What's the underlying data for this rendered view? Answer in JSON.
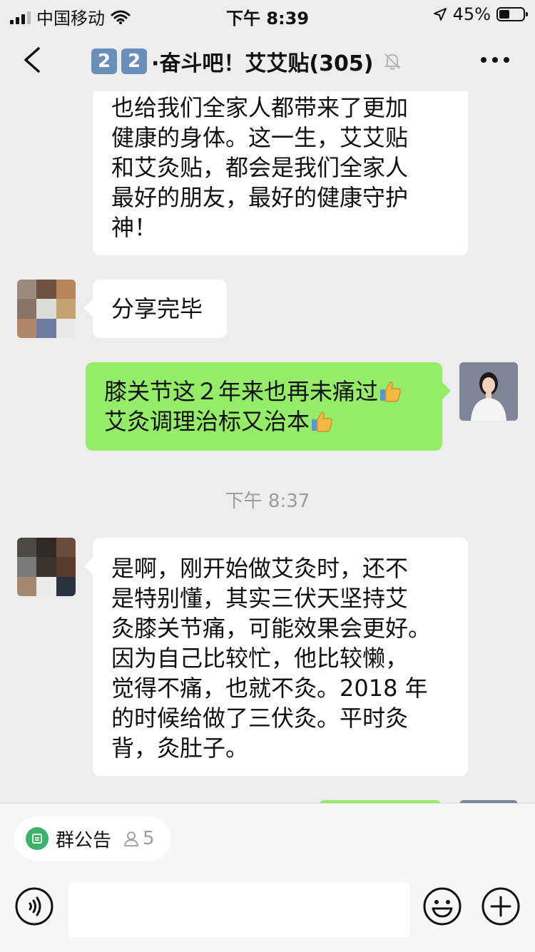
{
  "status_bar": {
    "carrier": "中国移动",
    "time": "下午 8:39",
    "battery": "45%",
    "battery_level": 0.45
  },
  "header": {
    "badge_1": "2",
    "badge_2": "2",
    "title": "·奋斗吧！艾艾贴(305)",
    "muted": true
  },
  "messages": {
    "m1_lines": [
      "也给我们全家人都带来了更加",
      "健康的身体。这一生，艾艾贴",
      "和艾灸贴，都会是我们全家人",
      "最好的朋友，最好的健康守护",
      "神！"
    ],
    "m2_text": "分享完毕",
    "m3_line1": "膝关节这２年来也再未痛过",
    "m3_line2": "艾灸调理治标又治本",
    "timestamp": "下午 8:37",
    "m4_lines": [
      "是啊，刚开始做艾灸时，还不",
      "是特别懂，其实三伏天坚持艾",
      "灸膝关节痛，可能效果会更好。",
      "因为自己比较忙，他比较懒，",
      "觉得不痛，也就不灸。2018 年",
      "的时候给做了三伏灸。平时灸",
      "背，灸肚子。"
    ]
  },
  "group_notice": {
    "label": "群公告",
    "count": "5"
  },
  "colors": {
    "background": "#ededed",
    "self_bubble": "#95ec69",
    "other_bubble": "#ffffff",
    "notice_green": "#3db167"
  }
}
